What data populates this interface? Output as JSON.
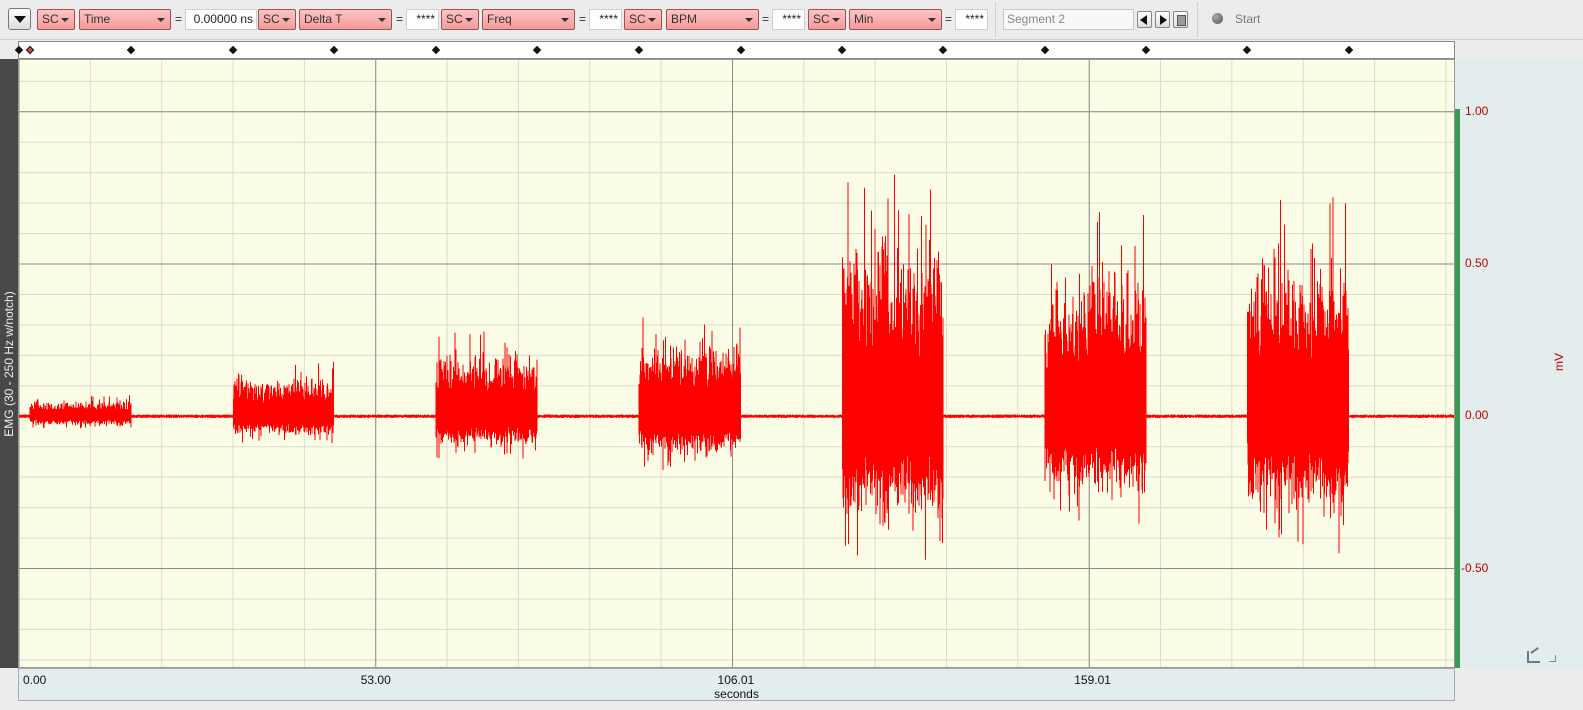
{
  "toolbar": {
    "measurements": [
      {
        "channel": "SC",
        "type": "Time",
        "value": "0.00000 ns"
      },
      {
        "channel": "SC",
        "type": "Delta T",
        "value": "****"
      },
      {
        "channel": "SC",
        "type": "Freq",
        "value": "****"
      },
      {
        "channel": "SC",
        "type": "BPM",
        "value": "****"
      },
      {
        "channel": "SC",
        "type": "Min",
        "value": "****"
      }
    ],
    "equals": "=",
    "segment_placeholder": "Segment 2",
    "start_label": "Start"
  },
  "channel": {
    "label": "EMG (30 - 250 Hz w/notch)",
    "unit": "mV",
    "color": "#ff0000"
  },
  "icons": [
    "menu-arrow-icon",
    "prev-segment-icon",
    "next-segment-icon",
    "last-segment-icon",
    "record-icon",
    "autoscale-icon",
    "resize-grip-icon"
  ],
  "chart_data": {
    "type": "line",
    "title": "",
    "xlabel": "seconds",
    "ylabel": "mV",
    "xlim": [
      0,
      213.5
    ],
    "ylim": [
      -0.83,
      1.17
    ],
    "x_ticks": [
      0.0,
      53.0,
      106.01,
      159.01
    ],
    "x_tick_labels": [
      "0.00",
      "53.00",
      "106.01",
      "159.01"
    ],
    "y_ticks": [
      1.0,
      0.5,
      0.0,
      -0.5
    ],
    "y_tick_labels": [
      "1.00",
      "0.50",
      "0.00",
      "-0.50"
    ],
    "grid": true,
    "event_markers_seconds": [
      0.0,
      1.6,
      16.7,
      31.8,
      46.8,
      61.9,
      77.0,
      92.1,
      107.2,
      122.3,
      137.3,
      152.4,
      167.5,
      182.5,
      197.6
    ],
    "series": [
      {
        "bursts": [
          {
            "start": 1.6,
            "end": 16.7,
            "amplitude_min": -0.04,
            "amplitude_max": 0.07
          },
          {
            "start": 31.8,
            "end": 46.8,
            "amplitude_min": -0.09,
            "amplitude_max": 0.18
          },
          {
            "start": 61.9,
            "end": 77.0,
            "amplitude_min": -0.14,
            "amplitude_max": 0.29
          },
          {
            "start": 92.1,
            "end": 107.2,
            "amplitude_min": -0.18,
            "amplitude_max": 0.35
          },
          {
            "start": 122.3,
            "end": 137.3,
            "amplitude_min": -0.5,
            "amplitude_max": 0.82
          },
          {
            "start": 152.4,
            "end": 167.5,
            "amplitude_min": -0.37,
            "amplitude_max": 0.68
          },
          {
            "start": 182.5,
            "end": 197.6,
            "amplitude_min": -0.45,
            "amplitude_max": 0.72
          }
        ],
        "baseline_noise": 0.004
      }
    ]
  }
}
